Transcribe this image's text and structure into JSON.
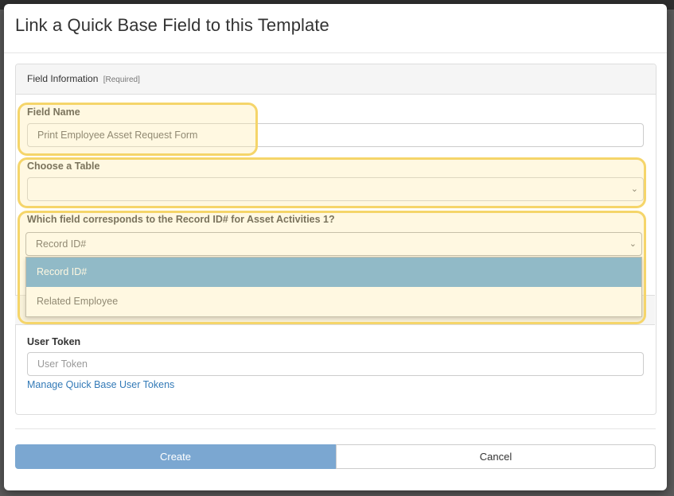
{
  "dialog": {
    "title": "Link a Quick Base Field to this Template"
  },
  "panel": {
    "heading": "Field Information",
    "heading_note": "[Required]"
  },
  "field_name": {
    "label": "Field Name",
    "value": "Print Employee Asset Request Form"
  },
  "choose_table": {
    "label": "Choose a Table",
    "value": ""
  },
  "record_field": {
    "label": "Which field corresponds to the Record ID# for Asset Activities 1?",
    "value": "Record ID#",
    "options": [
      "Record ID#",
      "Related Employee"
    ]
  },
  "user_token": {
    "label": "User Token",
    "placeholder": "User Token",
    "manage_link": "Manage Quick Base User Tokens"
  },
  "buttons": {
    "create": "Create",
    "cancel": "Cancel"
  },
  "colors": {
    "primary_button": "#7ba7d1",
    "option_highlight": "#56a0d8",
    "link": "#337ab7",
    "annotation": "#f5d56a"
  }
}
